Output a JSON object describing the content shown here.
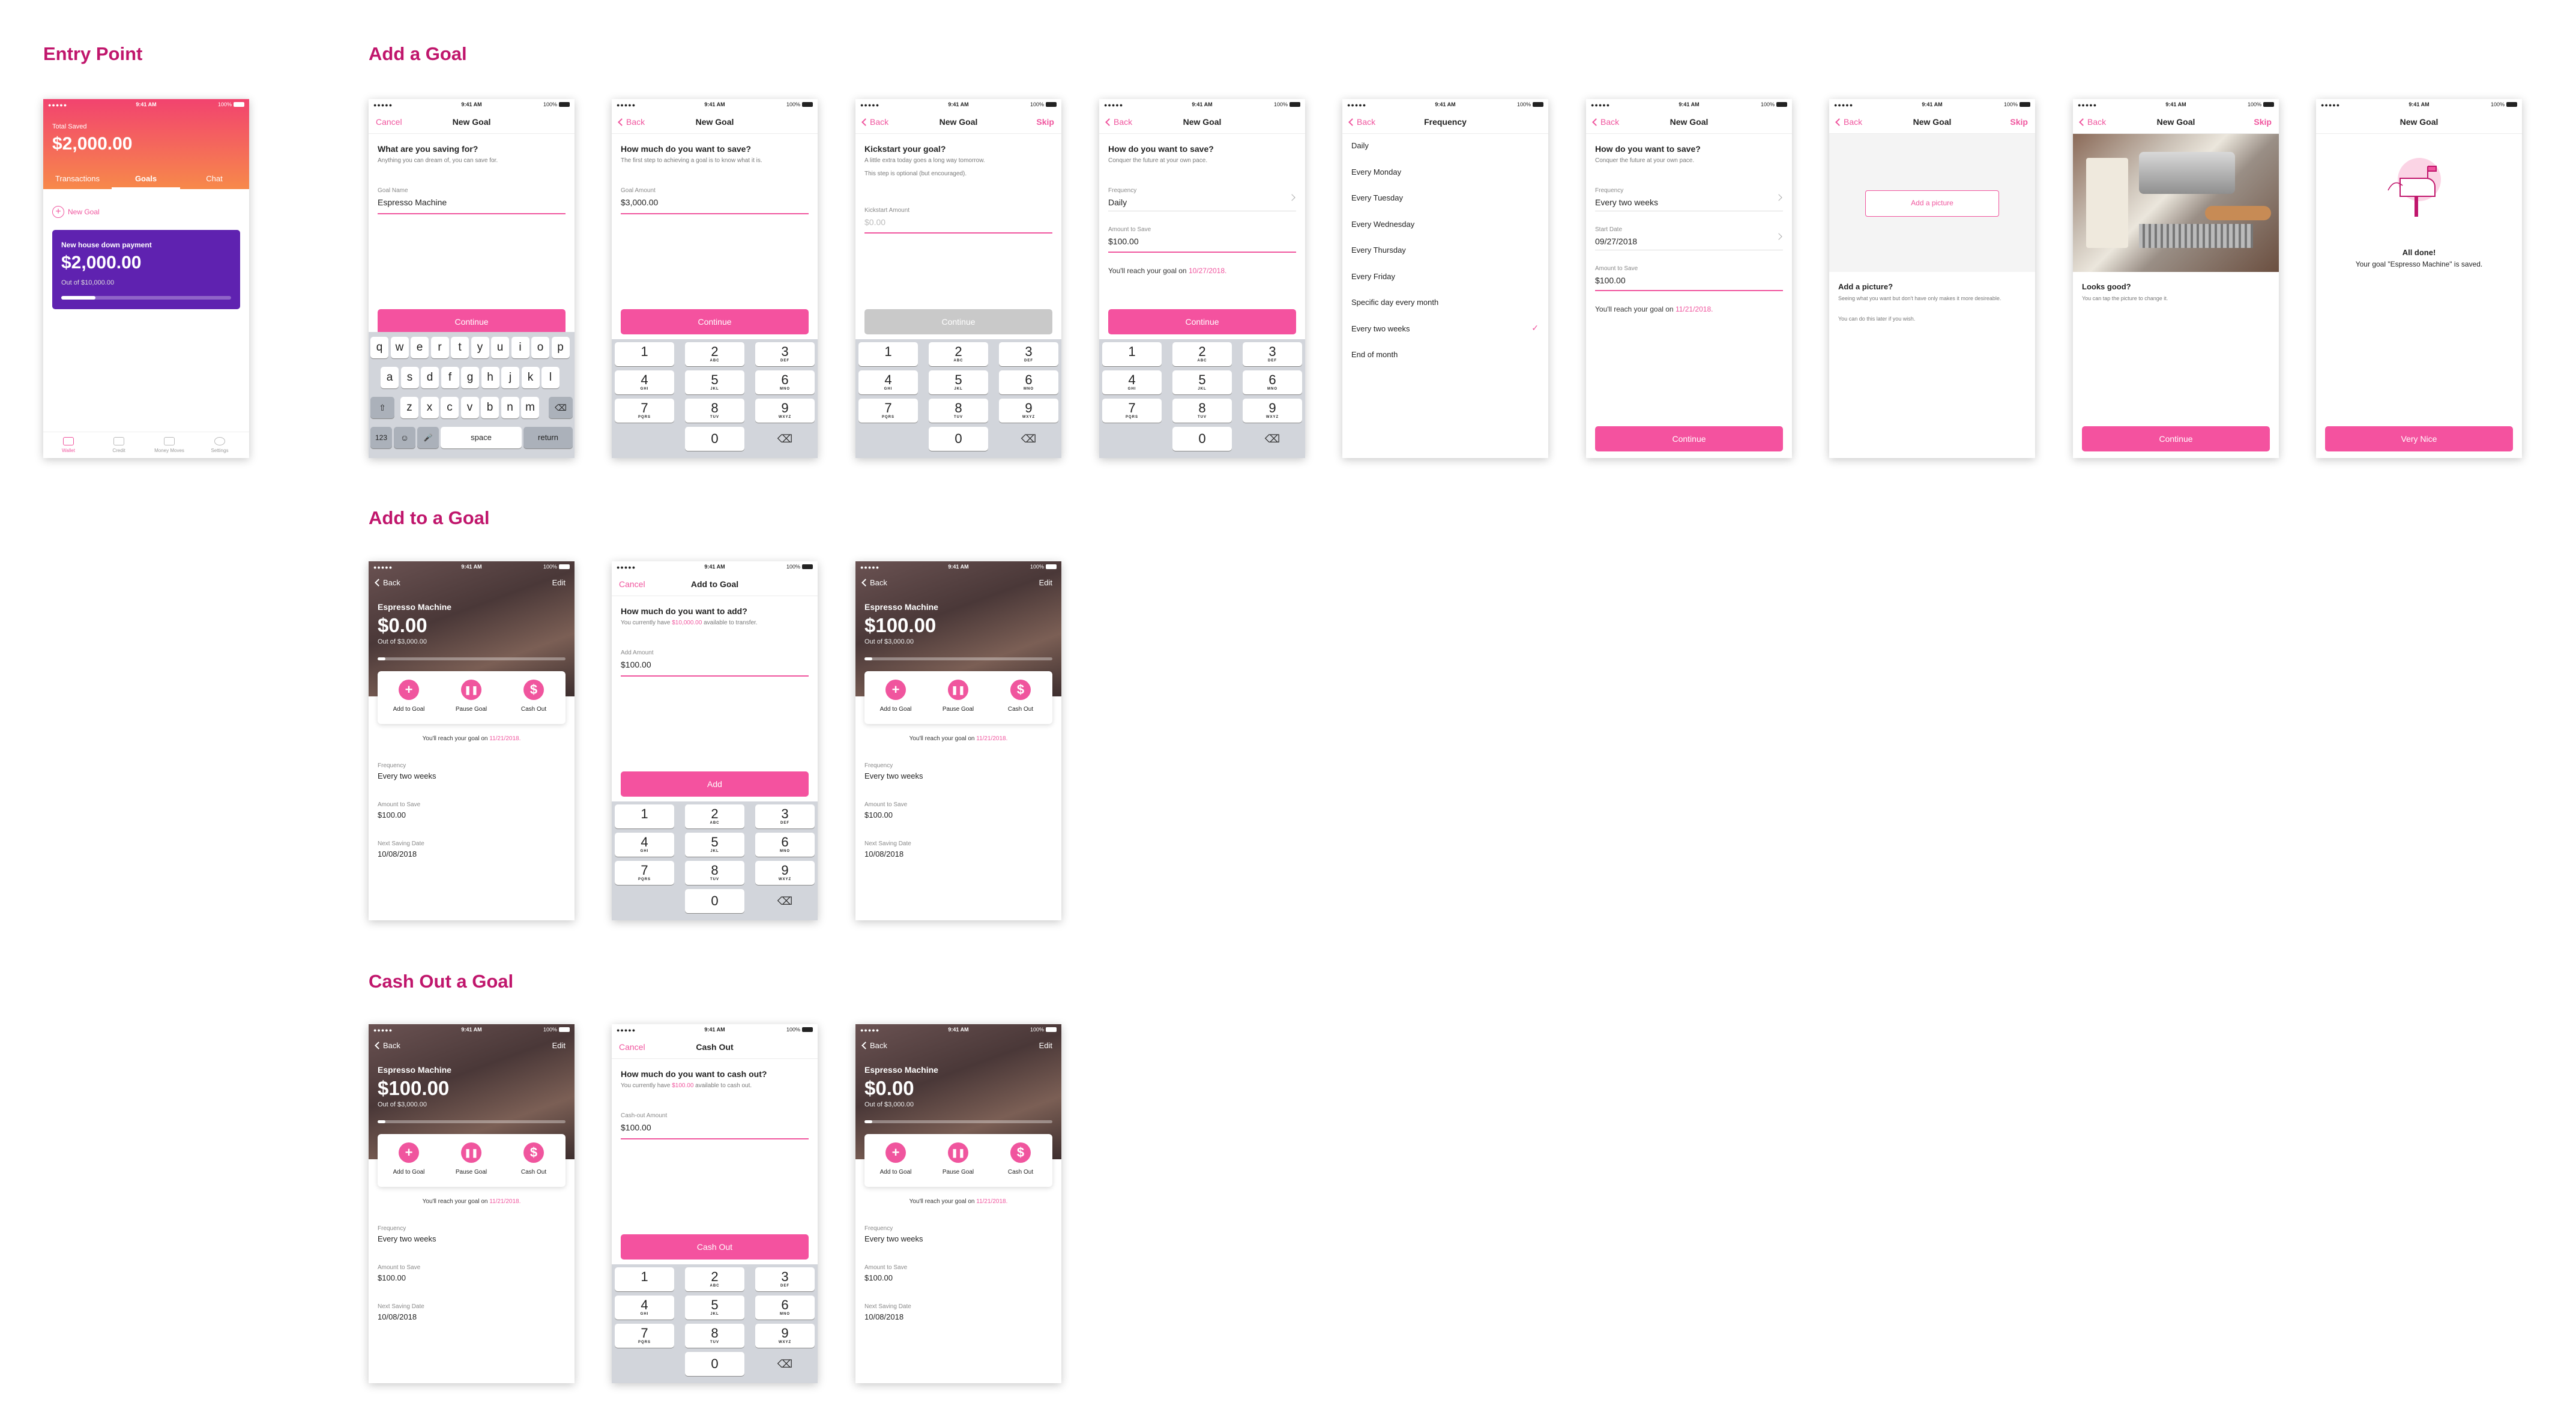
{
  "sections": {
    "entry": "Entry Point",
    "add_goal": "Add a Goal",
    "add_to_goal": "Add to a Goal",
    "cash_out": "Cash Out a Goal"
  },
  "colors": {
    "accent": "#f0559e",
    "heading": "#c0166c",
    "purple": "#5f22b0",
    "gradient_top": "#f2436f",
    "gradient_bottom": "#f7894a"
  },
  "status": {
    "time": "9:41 AM",
    "signal": "●●●●● ",
    "battery": "100%"
  },
  "keypad": {
    "rows": [
      [
        "1",
        "",
        ""
      ],
      [
        "2",
        "ABC",
        ""
      ],
      [
        "3",
        "DEF",
        ""
      ],
      [
        "4",
        "GHI",
        ""
      ],
      [
        "5",
        "JKL",
        ""
      ],
      [
        "6",
        "MNO",
        ""
      ],
      [
        "7",
        "PQRS",
        ""
      ],
      [
        "8",
        "TUV",
        ""
      ],
      [
        "9",
        "WXYZ",
        ""
      ]
    ],
    "zero": "0",
    "delete": "⌫"
  },
  "alpha_keys": {
    "row1": [
      "q",
      "w",
      "e",
      "r",
      "t",
      "y",
      "u",
      "i",
      "o",
      "p"
    ],
    "row2": [
      "a",
      "s",
      "d",
      "f",
      "g",
      "h",
      "j",
      "k",
      "l"
    ],
    "row3": [
      "z",
      "x",
      "c",
      "v",
      "b",
      "n",
      "m"
    ],
    "shift": "⇧",
    "del": "⌫",
    "num": "123",
    "emoji": "☺",
    "mic": "🎤",
    "space": "space",
    "return": "return"
  },
  "entry": {
    "total_label": "Total Saved",
    "total": "$2,000.00",
    "tabs": [
      "Transactions",
      "Goals",
      "Chat"
    ],
    "new_goal": "New Goal",
    "card": {
      "title": "New house down payment",
      "amount": "$2,000.00",
      "of": "Out of $10,000.00",
      "progress": 0.2
    },
    "tabbar": [
      "Wallet",
      "Credit",
      "Money Moves",
      "Settings"
    ]
  },
  "s1": {
    "left": "Cancel",
    "title": "New Goal",
    "q": "What are you saving for?",
    "sub": "Anything you can dream of, you can save for.",
    "label": "Goal Name",
    "value": "Espresso Machine",
    "button": "Continue"
  },
  "s2": {
    "left": "Back",
    "title": "New Goal",
    "q": "How much do you want to save?",
    "sub": "The first step to achieving a goal is to know what it is.",
    "label": "Goal Amount",
    "value": "$3,000.00",
    "button": "Continue"
  },
  "s3": {
    "left": "Back",
    "title": "New Goal",
    "right": "Skip",
    "q": "Kickstart your goal?",
    "sub": "A little extra today goes a long way tomorrow.",
    "sub2": "This step is optional (but encouraged).",
    "label": "Kickstart Amount",
    "placeholder": "$0.00",
    "button": "Continue"
  },
  "s4": {
    "left": "Back",
    "title": "New Goal",
    "q": "How do you want to save?",
    "sub": "Conquer the future at your own pace.",
    "freq_label": "Frequency",
    "freq": "Daily",
    "amt_label": "Amount to Save",
    "amt": "$100.00",
    "reach": "You'll reach your goal on ",
    "reach_date": "10/27/2018.",
    "button": "Continue"
  },
  "s5": {
    "left": "Back",
    "title": "Frequency",
    "options": [
      "Daily",
      "Every Monday",
      "Every Tuesday",
      "Every Wednesday",
      "Every Thursday",
      "Every Friday",
      "Specific day every month",
      "Every two weeks",
      "End of month"
    ],
    "selected": 7,
    "check": "✓"
  },
  "s6": {
    "left": "Back",
    "title": "New Goal",
    "q": "How do you want to save?",
    "sub": "Conquer the future at your own pace.",
    "freq_label": "Frequency",
    "freq": "Every two weeks",
    "start_label": "Start Date",
    "start": "09/27/2018",
    "amt_label": "Amount to Save",
    "amt": "$100.00",
    "reach": "You'll reach your goal on ",
    "reach_date": "11/21/2018.",
    "button": "Continue"
  },
  "s7": {
    "left": "Back",
    "title": "New Goal",
    "right": "Skip",
    "add_picture": "Add a picture",
    "q": "Add a picture?",
    "sub": "Seeing what you want but don't have only makes it more desireable.",
    "sub2": "You can do this later if you wish."
  },
  "s8": {
    "left": "Back",
    "title": "New Goal",
    "right": "Skip",
    "q": "Looks good?",
    "sub": "You can tap the picture to change it.",
    "button": "Continue"
  },
  "s9": {
    "title": "New Goal",
    "done": "All done!",
    "msg": "Your goal \"Espresso Machine\" is saved.",
    "button": "Very Nice"
  },
  "detail": {
    "back": "Back",
    "edit": "Edit",
    "name": "Espresso Machine",
    "of": "Out of $3,000.00",
    "actions": [
      "Add to Goal",
      "Pause Goal",
      "Cash Out"
    ],
    "reach": "You'll reach your goal on ",
    "reach_date": "11/21/2018.",
    "freq_label": "Frequency",
    "freq": "Every two weeks",
    "amt_label": "Amount to Save",
    "amt": "$100.00",
    "next_label": "Next Saving Date",
    "next": "10/08/2018",
    "amount_zero": "$0.00",
    "amount_hundred": "$100.00"
  },
  "add": {
    "left": "Cancel",
    "title": "Add to Goal",
    "q": "How much do you want to add?",
    "sub_a": "You currently have ",
    "sub_hl": "$10,000.00",
    "sub_b": " available to transfer.",
    "label": "Add Amount",
    "value": "$100.00",
    "button": "Add"
  },
  "cash": {
    "left": "Cancel",
    "title": "Cash Out",
    "q": "How much do you want to cash out?",
    "sub_a": "You currently have ",
    "sub_hl": "$100.00",
    "sub_b": " available to cash out.",
    "label": "Cash-out Amount",
    "value": "$100.00",
    "button": "Cash Out"
  }
}
